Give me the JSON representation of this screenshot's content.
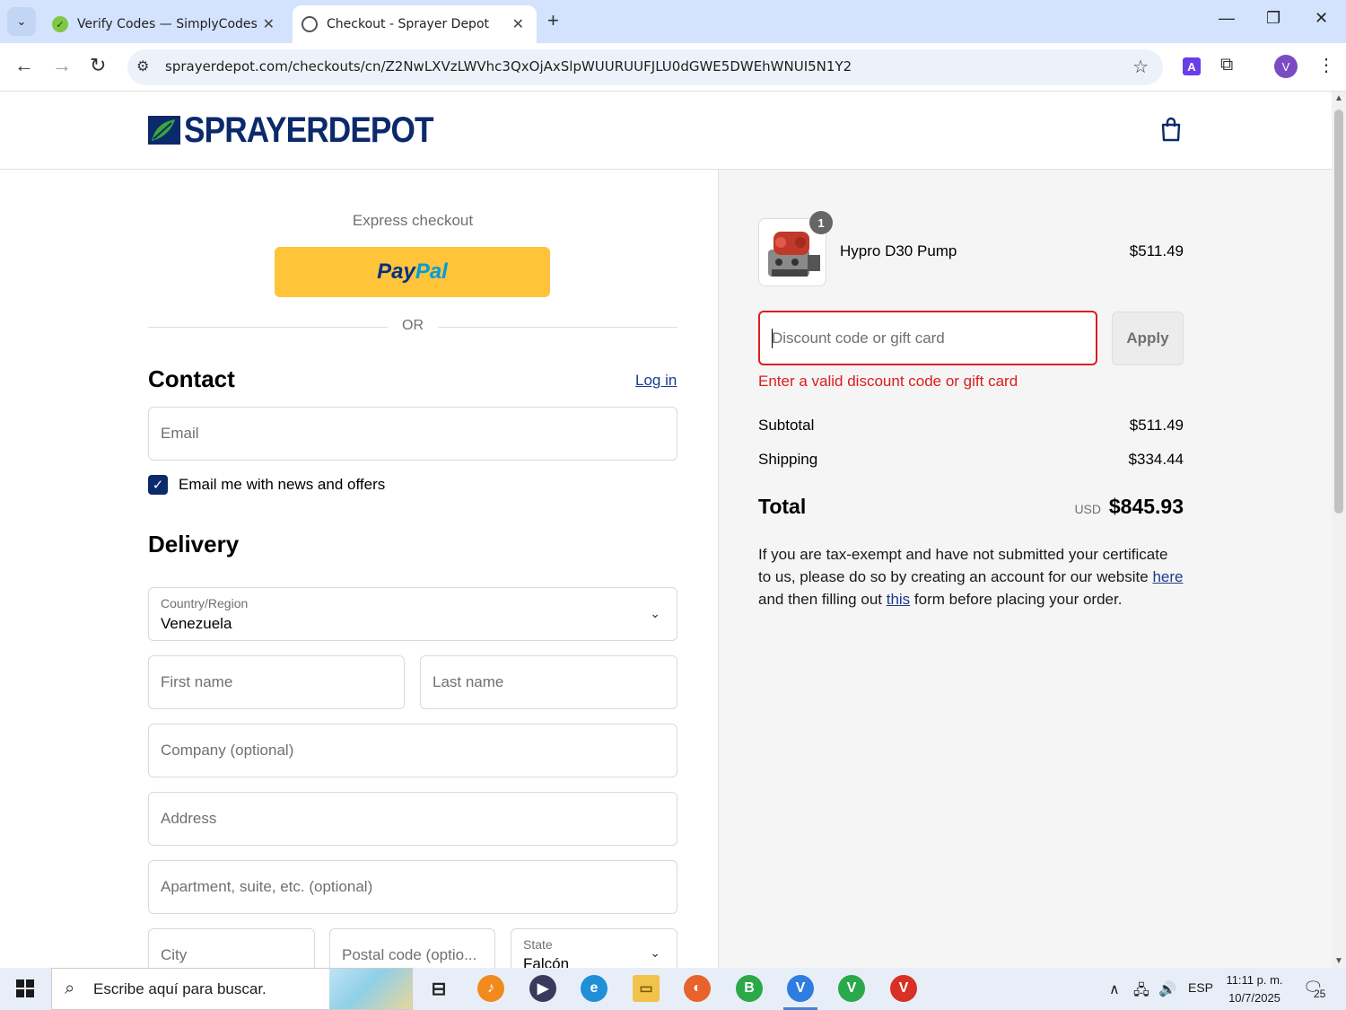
{
  "browser": {
    "tabs": [
      {
        "title": "Verify Codes — SimplyCodes",
        "close": "✕"
      },
      {
        "title": "Checkout - Sprayer Depot",
        "close": "✕"
      }
    ],
    "new_tab": "+",
    "url": "sprayerdepot.com/checkouts/cn/Z2NwLXVzLWVhc3QxOjAxSlpWUURUUFJLU0dGWE5DWEhWNUI5N1Y2",
    "profile_initial": "V",
    "extension_letter": "A"
  },
  "store": {
    "logo_text_1": "SPRAYER",
    "logo_text_2": "DEPOT"
  },
  "checkout": {
    "express_label": "Express checkout",
    "paypal_part1": "Pay",
    "paypal_part2": "Pal",
    "or_text": "OR",
    "contact_title": "Contact",
    "login_label": "Log in",
    "email_placeholder": "Email",
    "newsletter_label": "Email me with news and offers",
    "newsletter_checked": true,
    "delivery_title": "Delivery",
    "country_label": "Country/Region",
    "country_value": "Venezuela",
    "first_name_placeholder": "First name",
    "last_name_placeholder": "Last name",
    "company_placeholder": "Company (optional)",
    "address_placeholder": "Address",
    "apartment_placeholder": "Apartment, suite, etc. (optional)",
    "city_placeholder": "City",
    "postal_placeholder": "Postal code (optio...",
    "state_label": "State",
    "state_value": "Falcón"
  },
  "summary": {
    "product_name": "Hypro D30 Pump",
    "product_price": "$511.49",
    "product_qty": "1",
    "discount_placeholder": "Discount code or gift card",
    "apply_label": "Apply",
    "discount_error": "Enter a valid discount code or gift card",
    "subtotal_label": "Subtotal",
    "subtotal_value": "$511.49",
    "shipping_label": "Shipping",
    "shipping_value": "$334.44",
    "total_label": "Total",
    "total_currency": "USD",
    "total_value": "$845.93",
    "tax_note_1": "If you are tax-exempt and have not submitted your certificate to us, please do so by creating an account for our website ",
    "tax_link_here": "here",
    "tax_note_2": " and then filling out ",
    "tax_link_this": "this",
    "tax_note_3": " form before placing your order."
  },
  "taskbar": {
    "search_text": "Escribe aquí para buscar.",
    "language": "ESP",
    "time": "11:11 p. m.",
    "date": "10/7/2025",
    "notifications": "25"
  },
  "colors": {
    "accent_navy": "#0b2a6b",
    "error_red": "#dd1d1d",
    "paypal_yellow": "#ffc439",
    "link_blue": "#1a3a8f"
  }
}
